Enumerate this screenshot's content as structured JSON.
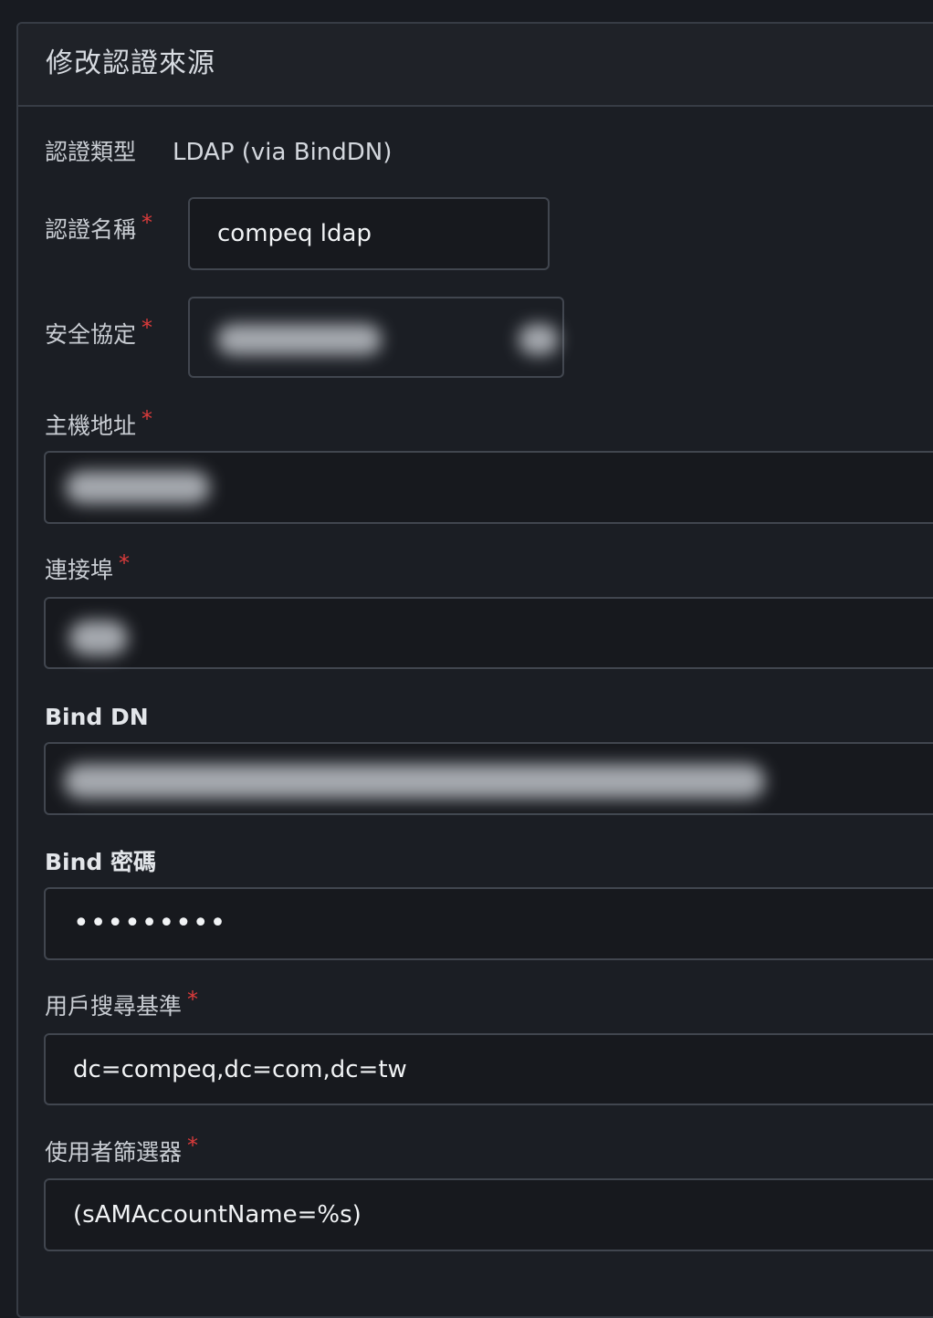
{
  "panel": {
    "title": "修改認證來源"
  },
  "form": {
    "auth_type": {
      "label": "認證類型",
      "value": "LDAP (via BindDN)"
    },
    "auth_name": {
      "label": "認證名稱",
      "value": "compeq ldap",
      "required_mark": "*"
    },
    "security_protocol": {
      "label": "安全協定",
      "required_mark": "*"
    },
    "host": {
      "label": "主機地址",
      "required_mark": "*"
    },
    "port": {
      "label": "連接埠",
      "required_mark": "*"
    },
    "bind_dn": {
      "label": "Bind DN"
    },
    "bind_password": {
      "label": "Bind 密碼",
      "masked_value": "•••••••••"
    },
    "user_search_base": {
      "label": "用戶搜尋基準",
      "value": "dc=compeq,dc=com,dc=tw",
      "required_mark": "*"
    },
    "user_filter": {
      "label": "使用者篩選器",
      "value": "(sAMAccountName=%s)",
      "required_mark": "*"
    }
  },
  "colors": {
    "background": "#181b21",
    "panel": "#1b1e24",
    "border": "#41464f",
    "required": "#db3b3b",
    "text": "#d7dbe1"
  }
}
